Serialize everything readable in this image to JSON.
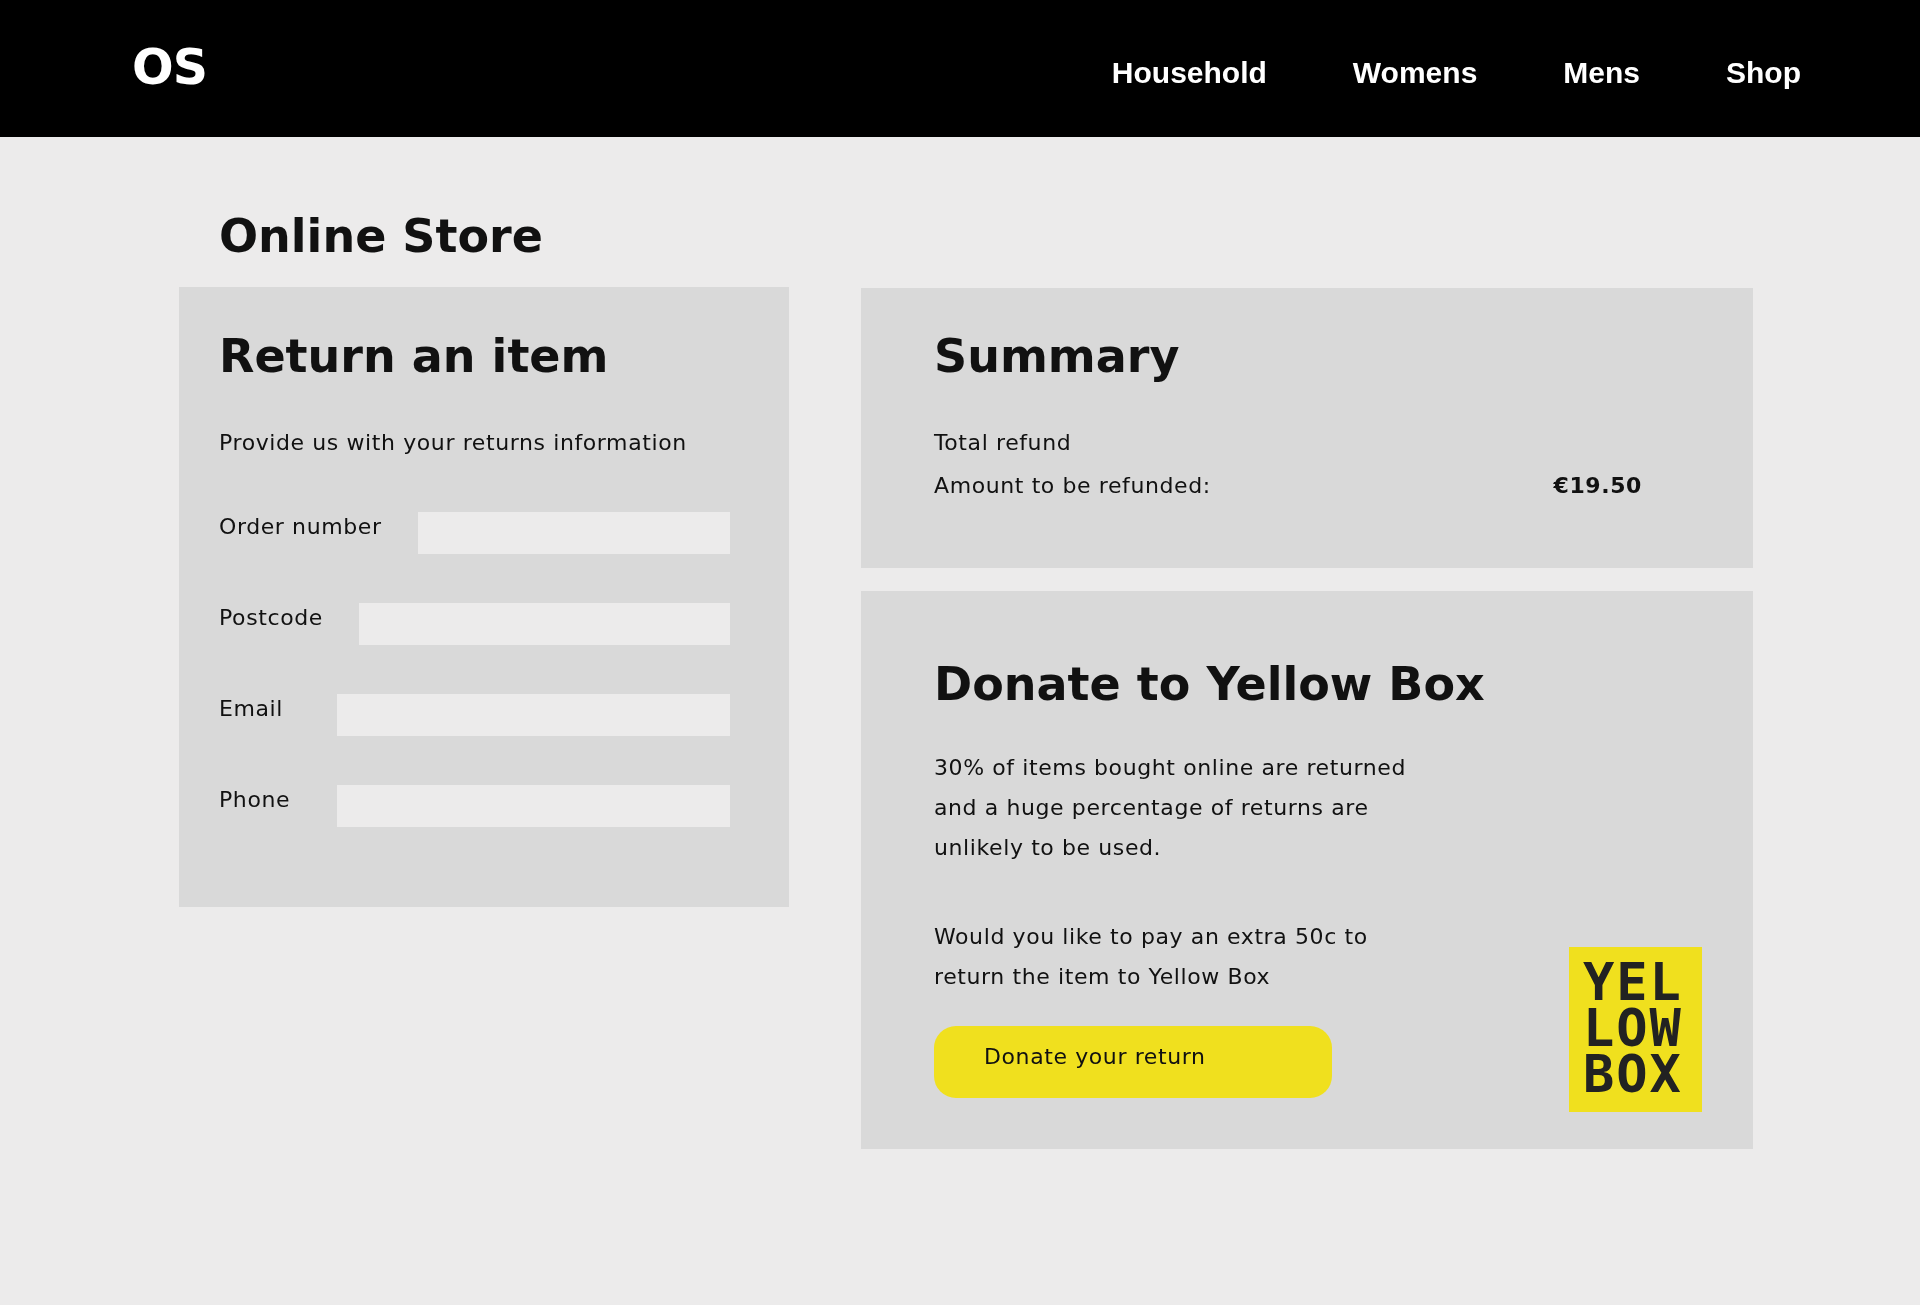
{
  "header": {
    "logo": "OS",
    "nav": [
      "Household",
      "Womens",
      "Mens",
      "Shop"
    ]
  },
  "page_title": "Online Store",
  "return_form": {
    "title": "Return an item",
    "subtitle": "Provide us with your returns information",
    "fields": [
      {
        "label": "Order number"
      },
      {
        "label": "Postcode"
      },
      {
        "label": "Email"
      },
      {
        "label": "Phone"
      }
    ]
  },
  "summary": {
    "title": "Summary",
    "subtitle": "Total refund",
    "rows": [
      {
        "label": "Amount to be refunded:",
        "value": "€19.50"
      }
    ]
  },
  "donate": {
    "title": "Donate to Yellow Box",
    "paragraphs": [
      "30% of items bought online are returned and a huge percentage of returns are unlikely to be used.",
      "Would you like to pay an extra 50c to return the item to Yellow Box"
    ],
    "button": "Donate your return",
    "logo_lines": [
      "YEL",
      "LOW",
      "BOX"
    ]
  }
}
